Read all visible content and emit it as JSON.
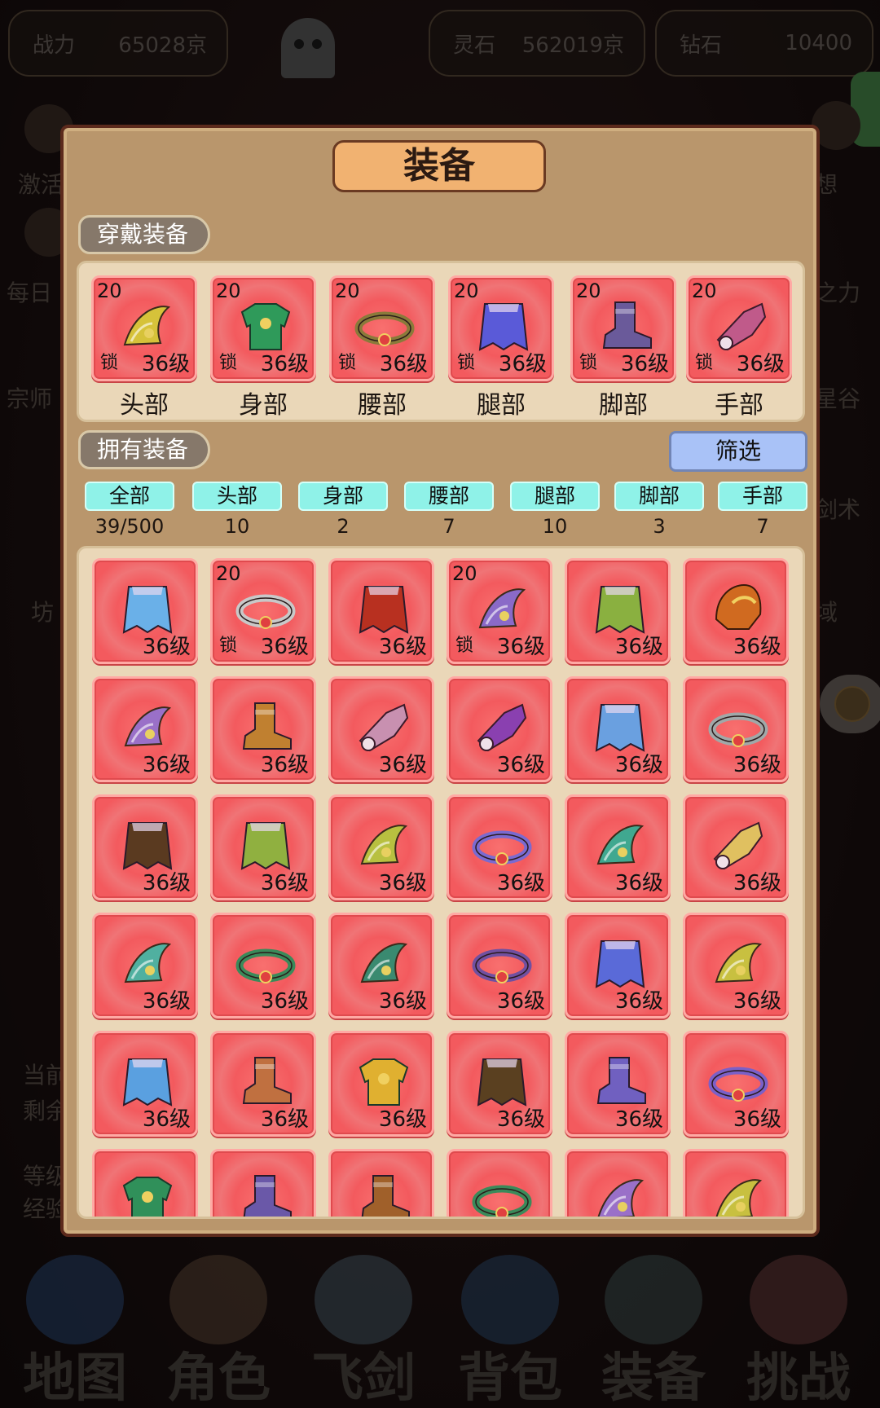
{
  "top_bar": {
    "power_label": "战力",
    "power_value": "65028京",
    "stone_label": "灵石",
    "stone_value": "562019京",
    "diamond_label": "钻石",
    "diamond_value": "10400"
  },
  "bg_side_labels": {
    "left": [
      "激活",
      "每日",
      "宗师",
      "坊",
      "当前",
      "剩余",
      "等级",
      "经验"
    ],
    "right": [
      "想",
      "之力",
      "星谷",
      "剑术",
      "域"
    ]
  },
  "bottom_nav": [
    "地图",
    "角色",
    "飞剑",
    "背包",
    "装备",
    "挑战"
  ],
  "panel": {
    "title": "装备",
    "worn_header": "穿戴装备",
    "owned_header": "拥有装备",
    "filter_label": "筛选",
    "worn": [
      {
        "slot": "头部",
        "plus": "20",
        "lock": "锁",
        "level": "36级",
        "icon": "helmet-wing-icon",
        "color": "#d6c23a"
      },
      {
        "slot": "身部",
        "plus": "20",
        "lock": "锁",
        "level": "36级",
        "icon": "armor-icon",
        "color": "#2f9a5a"
      },
      {
        "slot": "腰部",
        "plus": "20",
        "lock": "锁",
        "level": "36级",
        "icon": "belt-icon",
        "color": "#8a7a3a"
      },
      {
        "slot": "腿部",
        "plus": "20",
        "lock": "锁",
        "level": "36级",
        "icon": "legguard-icon",
        "color": "#5a5ad8"
      },
      {
        "slot": "脚部",
        "plus": "20",
        "lock": "锁",
        "level": "36级",
        "icon": "boots-icon",
        "color": "#6a5a9a"
      },
      {
        "slot": "手部",
        "plus": "20",
        "lock": "锁",
        "level": "36级",
        "icon": "gauntlet-icon",
        "color": "#c05a8a"
      }
    ],
    "tabs": [
      {
        "label": "全部",
        "count": "39/500"
      },
      {
        "label": "头部",
        "count": "10"
      },
      {
        "label": "身部",
        "count": "2"
      },
      {
        "label": "腰部",
        "count": "7"
      },
      {
        "label": "腿部",
        "count": "10"
      },
      {
        "label": "脚部",
        "count": "3"
      },
      {
        "label": "手部",
        "count": "7"
      }
    ],
    "owned": [
      {
        "plus": "",
        "lock": "",
        "level": "36级",
        "icon": "legguard-icon",
        "color": "#6ab0e8"
      },
      {
        "plus": "20",
        "lock": "锁",
        "level": "36级",
        "icon": "belt-icon",
        "color": "#c8c8c8"
      },
      {
        "plus": "",
        "lock": "",
        "level": "36级",
        "icon": "legguard-icon",
        "color": "#b83020"
      },
      {
        "plus": "20",
        "lock": "锁",
        "level": "36级",
        "icon": "helmet-wing-icon",
        "color": "#8a6ac8"
      },
      {
        "plus": "",
        "lock": "",
        "level": "36级",
        "icon": "legguard-icon",
        "color": "#8ab040"
      },
      {
        "plus": "",
        "lock": "",
        "level": "36级",
        "icon": "helmet-icon",
        "color": "#d06a20"
      },
      {
        "plus": "",
        "lock": "",
        "level": "36级",
        "icon": "helmet-wing-icon",
        "color": "#9a70c8"
      },
      {
        "plus": "",
        "lock": "",
        "level": "36级",
        "icon": "boots-icon",
        "color": "#c08030"
      },
      {
        "plus": "",
        "lock": "",
        "level": "36级",
        "icon": "gauntlet-icon",
        "color": "#c890b0"
      },
      {
        "plus": "",
        "lock": "",
        "level": "36级",
        "icon": "gauntlet-icon",
        "color": "#8a40b0"
      },
      {
        "plus": "",
        "lock": "",
        "level": "36级",
        "icon": "legguard-icon",
        "color": "#6aa0e0"
      },
      {
        "plus": "",
        "lock": "",
        "level": "36级",
        "icon": "belt-icon",
        "color": "#a0a8a8"
      },
      {
        "plus": "",
        "lock": "",
        "level": "36级",
        "icon": "legguard-icon",
        "color": "#5a3a20"
      },
      {
        "plus": "",
        "lock": "",
        "level": "36级",
        "icon": "legguard-icon",
        "color": "#90b040"
      },
      {
        "plus": "",
        "lock": "",
        "level": "36级",
        "icon": "helmet-wing-icon",
        "color": "#b8c040"
      },
      {
        "plus": "",
        "lock": "",
        "level": "36级",
        "icon": "belt-icon",
        "color": "#7a6ad0"
      },
      {
        "plus": "",
        "lock": "",
        "level": "36级",
        "icon": "helmet-wing-icon",
        "color": "#40a890"
      },
      {
        "plus": "",
        "lock": "",
        "level": "36级",
        "icon": "gauntlet-icon",
        "color": "#e0c060"
      },
      {
        "plus": "",
        "lock": "",
        "level": "36级",
        "icon": "helmet-wing-icon",
        "color": "#50b0a0"
      },
      {
        "plus": "",
        "lock": "",
        "level": "36级",
        "icon": "belt-icon",
        "color": "#3a8a5a"
      },
      {
        "plus": "",
        "lock": "",
        "level": "36级",
        "icon": "helmet-wing-icon",
        "color": "#3a8a70"
      },
      {
        "plus": "",
        "lock": "",
        "level": "36级",
        "icon": "belt-icon",
        "color": "#7050a0"
      },
      {
        "plus": "",
        "lock": "",
        "level": "36级",
        "icon": "legguard-icon",
        "color": "#5a6ad8"
      },
      {
        "plus": "",
        "lock": "",
        "level": "36级",
        "icon": "helmet-wing-icon",
        "color": "#c8c040"
      },
      {
        "plus": "",
        "lock": "",
        "level": "36级",
        "icon": "legguard-icon",
        "color": "#5aa0e0"
      },
      {
        "plus": "",
        "lock": "",
        "level": "36级",
        "icon": "boots-icon",
        "color": "#c07040"
      },
      {
        "plus": "",
        "lock": "",
        "level": "36级",
        "icon": "armor-icon",
        "color": "#e0b030"
      },
      {
        "plus": "",
        "lock": "",
        "level": "36级",
        "icon": "legguard-icon",
        "color": "#5a4020"
      },
      {
        "plus": "",
        "lock": "",
        "level": "36级",
        "icon": "boots-icon",
        "color": "#7060c0"
      },
      {
        "plus": "",
        "lock": "",
        "level": "36级",
        "icon": "belt-icon",
        "color": "#7a60c8"
      },
      {
        "plus": "",
        "lock": "",
        "level": "",
        "icon": "armor-icon",
        "color": "#30905a"
      },
      {
        "plus": "",
        "lock": "",
        "level": "",
        "icon": "boots-icon",
        "color": "#6a58a8"
      },
      {
        "plus": "",
        "lock": "",
        "level": "",
        "icon": "boots-icon",
        "color": "#a0602a"
      },
      {
        "plus": "",
        "lock": "",
        "level": "",
        "icon": "belt-icon",
        "color": "#3a8a5a"
      },
      {
        "plus": "",
        "lock": "",
        "level": "",
        "icon": "helmet-wing-icon",
        "color": "#9a70c8"
      },
      {
        "plus": "",
        "lock": "",
        "level": "",
        "icon": "helmet-wing-icon",
        "color": "#c8c040"
      }
    ]
  }
}
